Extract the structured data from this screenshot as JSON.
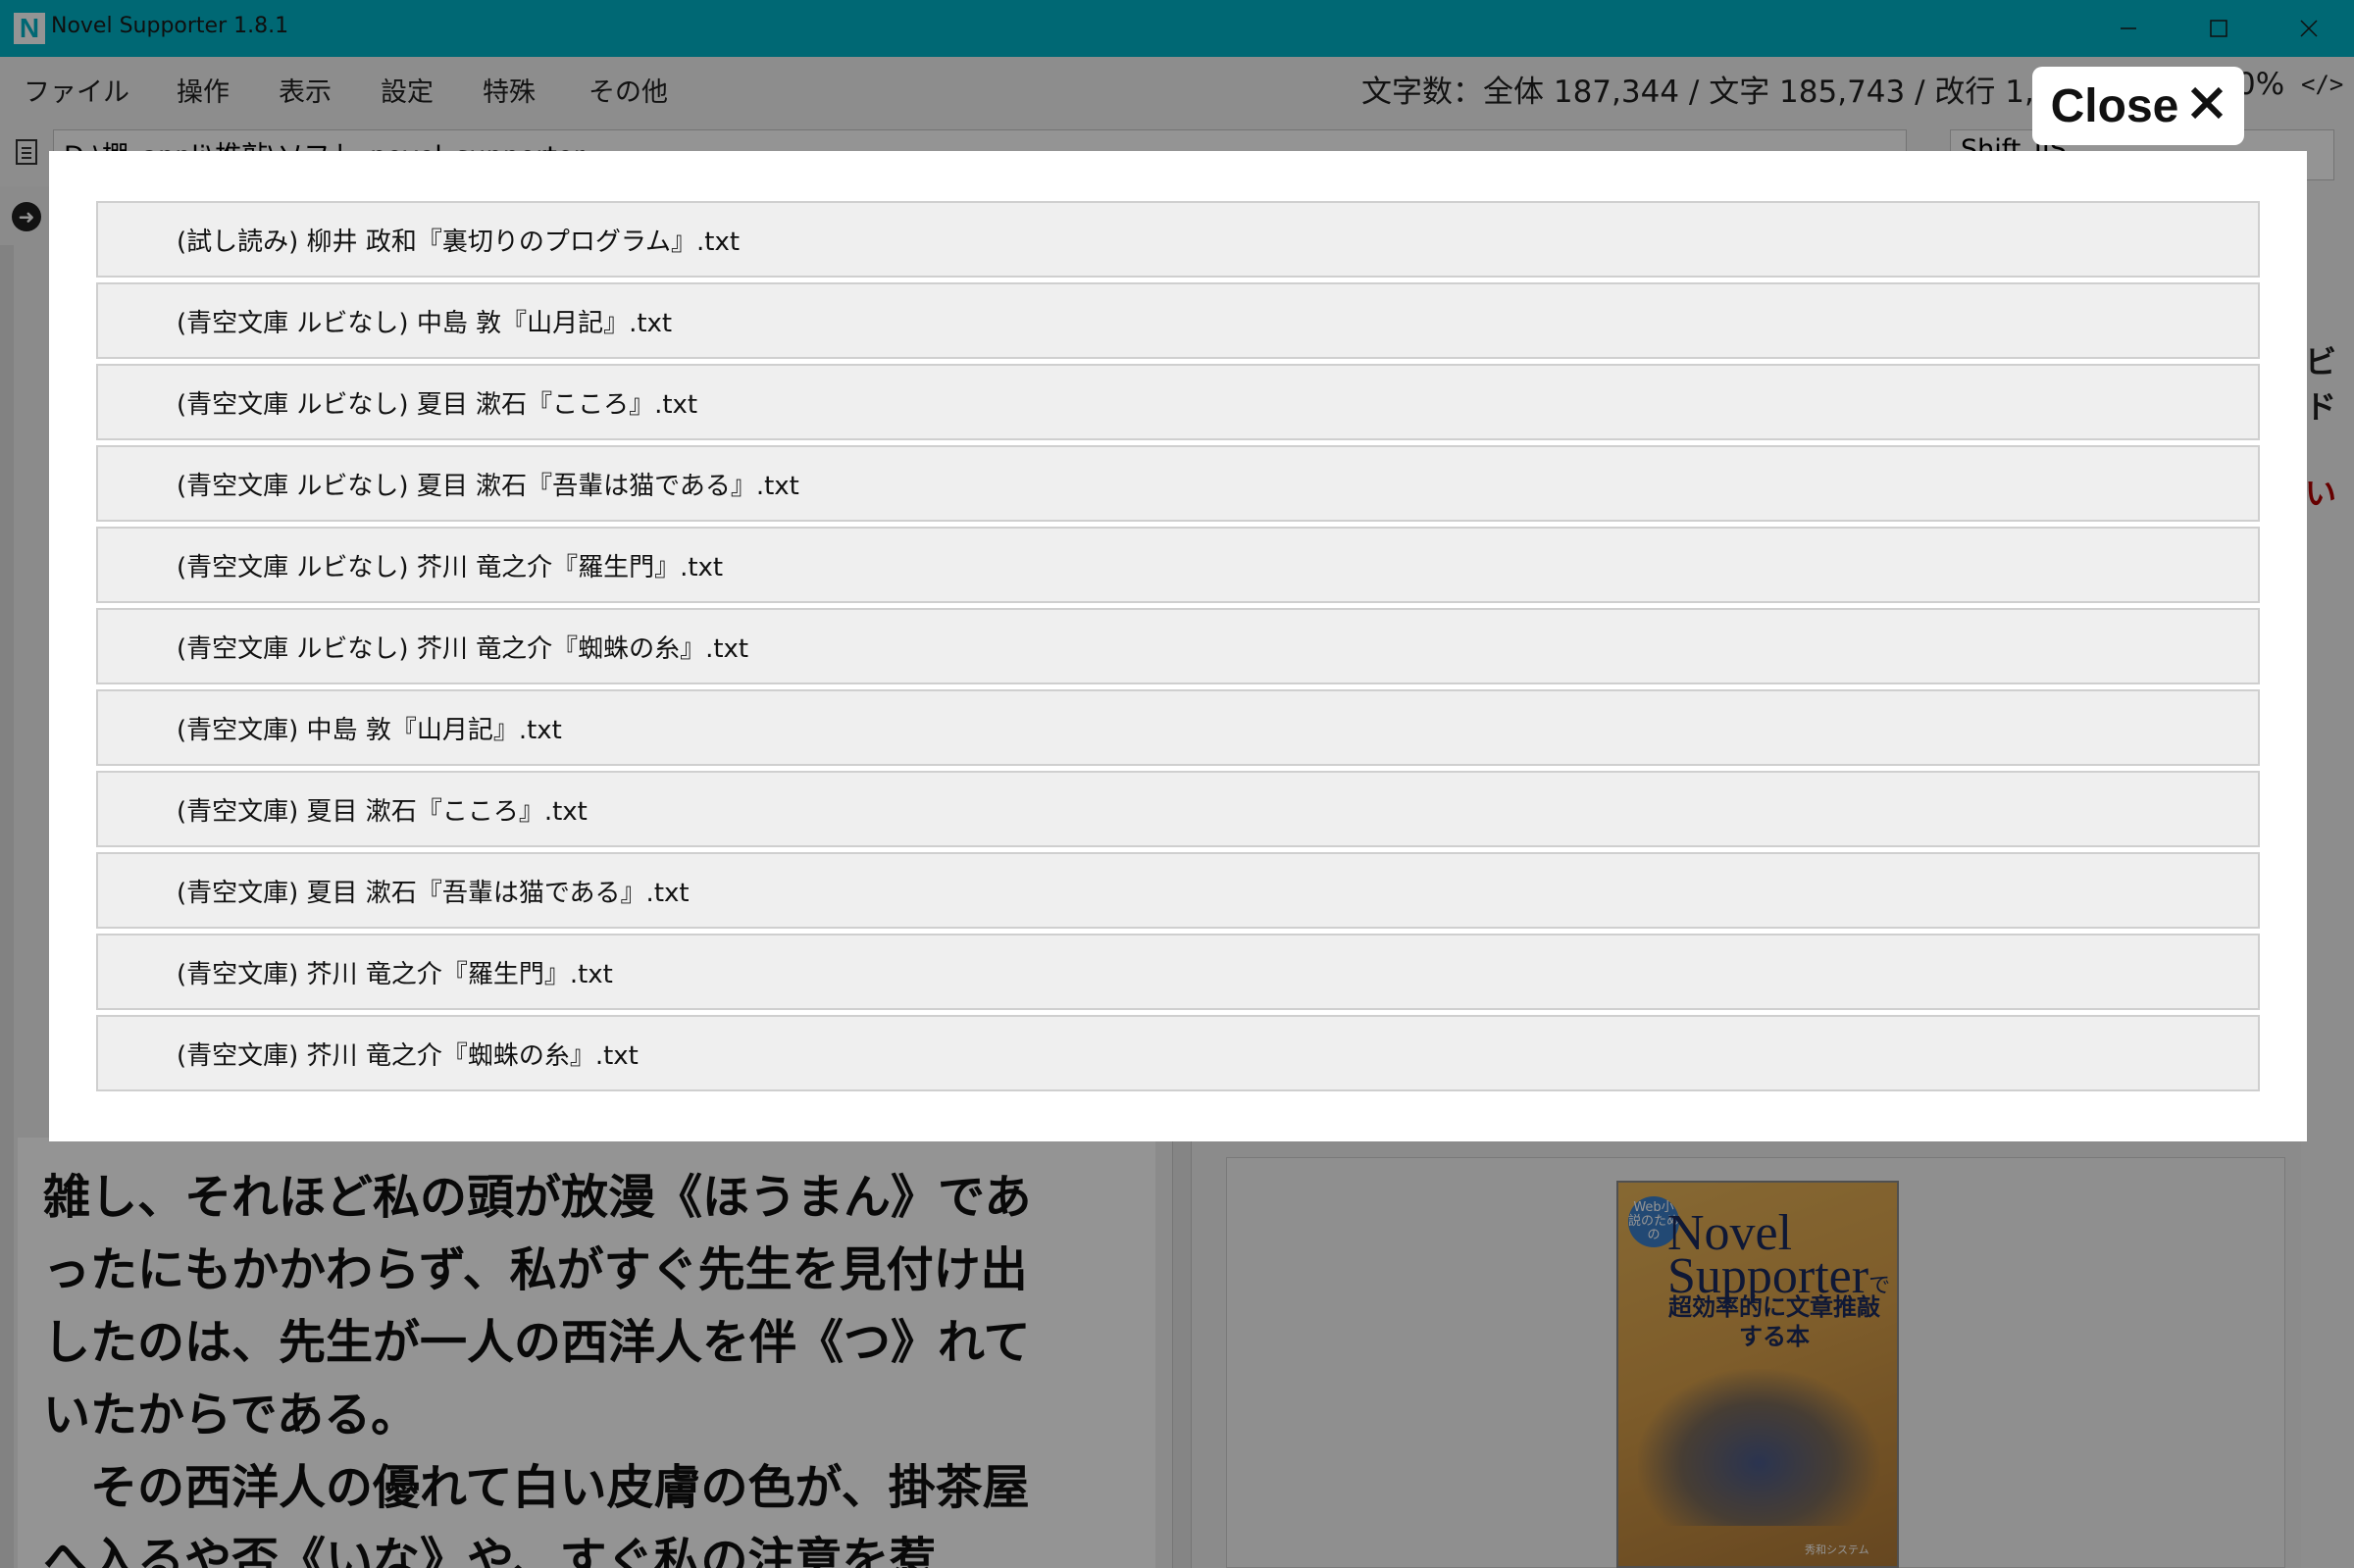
{
  "window": {
    "title": "Novel Supporter 1.8.1",
    "icon_letter": "N",
    "controls": {
      "minimize": "—",
      "maximize": "☐",
      "close": "✕"
    }
  },
  "menu": {
    "items": [
      "ファイル",
      "操作",
      "表示",
      "設定",
      "特殊",
      "その他"
    ],
    "counter": "文字数：全体 187,344 / 文字 185,743 / 改行 1,",
    "zoom": "0%",
    "code_icon": "</>"
  },
  "pathbar": {
    "path": "D:\\棚_appli\\推敲\\ソフト_novel_supporter",
    "encoding": "Shift_JIS"
  },
  "side": {
    "right_text_1": "ビ",
    "right_text_2": "ド",
    "right_text_3": "い"
  },
  "editor": {
    "lines": [
      "雑し、それほど私の頭が放漫《ほうまん》であ",
      "ったにもかかわらず、私がすぐ先生を見付け出",
      "したのは、先生が一人の西洋人を伴《つ》れて",
      "いたからである。",
      "　その西洋人の優れて白い皮膚の色が、掛茶屋",
      "へ入るや否《いな》や、すぐ私の注意を惹"
    ]
  },
  "preview": {
    "badge": "Web小説のための",
    "title": "Novel Supporter",
    "title_suffix": "で",
    "subtitle_1": "超効率的に文章推敲",
    "subtitle_2": "する本",
    "publisher": "秀和システム"
  },
  "modal": {
    "close_label": "Close",
    "close_icon": "✕",
    "files": [
      "(試し読み) 柳井 政和『裏切りのプログラム』.txt",
      "(青空文庫 ルビなし) 中島 敦『山月記』.txt",
      "(青空文庫 ルビなし) 夏目 漱石『こころ』.txt",
      "(青空文庫 ルビなし) 夏目 漱石『吾輩は猫である』.txt",
      "(青空文庫 ルビなし) 芥川 竜之介『羅生門』.txt",
      "(青空文庫 ルビなし) 芥川 竜之介『蜘蛛の糸』.txt",
      "(青空文庫) 中島 敦『山月記』.txt",
      "(青空文庫) 夏目 漱石『こころ』.txt",
      "(青空文庫) 夏目 漱石『吾輩は猫である』.txt",
      "(青空文庫) 芥川 竜之介『羅生門』.txt",
      "(青空文庫) 芥川 竜之介『蜘蛛の糸』.txt"
    ]
  },
  "colors": {
    "titlebar": "#00b4c8",
    "overlay": "rgba(0,0,0,0.42)",
    "row_background": "#efefef"
  }
}
